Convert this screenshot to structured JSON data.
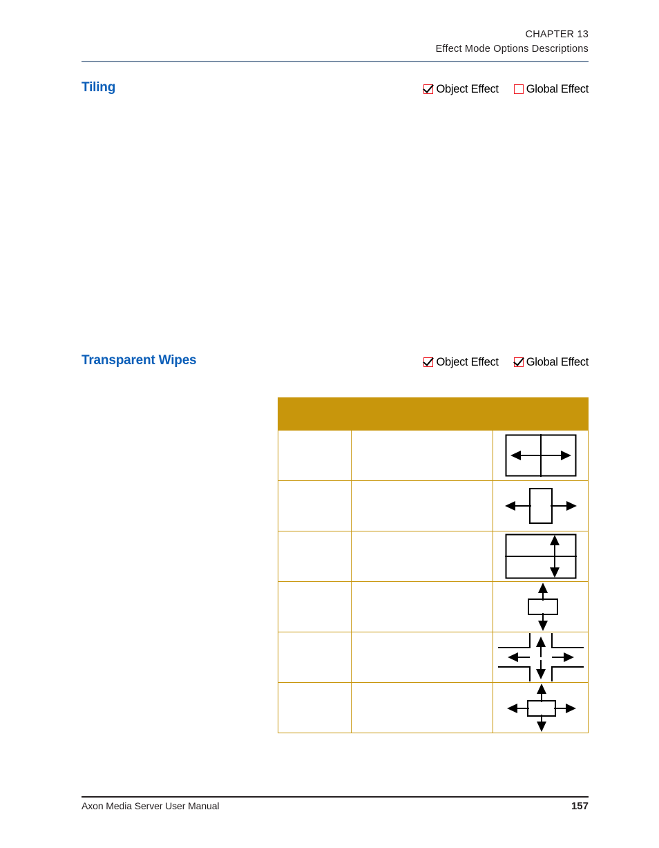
{
  "header": {
    "chapter_label": "CHAPTER 13",
    "chapter_title": "Effect Mode Options Descriptions",
    "rule_color": "#7b90a8"
  },
  "colors": {
    "heading_blue": "#0b5eb8",
    "table_gold": "#c8960c",
    "checkbox_red": "#ee1c25",
    "body_black": "#231f20"
  },
  "sections": [
    {
      "title": "Tiling",
      "flags": [
        {
          "label": "Object Effect",
          "checked": true,
          "icon": "checkbox-checked-icon"
        },
        {
          "label": "Global Effect",
          "checked": false,
          "icon": "checkbox-unchecked-icon"
        }
      ]
    },
    {
      "title": "Transparent Wipes",
      "flags": [
        {
          "label": "Object Effect",
          "checked": true,
          "icon": "checkbox-checked-icon"
        },
        {
          "label": "Global Effect",
          "checked": true,
          "icon": "checkbox-checked-icon"
        }
      ]
    }
  ],
  "wipe_table": {
    "columns": [
      "",
      "",
      ""
    ],
    "rows": [
      {
        "name": "",
        "description": "",
        "icon": "wipe-split-horizontal-outward-icon"
      },
      {
        "name": "",
        "description": "",
        "icon": "wipe-box-horizontal-outward-icon"
      },
      {
        "name": "",
        "description": "",
        "icon": "wipe-split-vertical-outward-icon"
      },
      {
        "name": "",
        "description": "",
        "icon": "wipe-box-vertical-outward-icon"
      },
      {
        "name": "",
        "description": "",
        "icon": "wipe-quadrant-open-icon"
      },
      {
        "name": "",
        "description": "",
        "icon": "wipe-box-four-way-outward-icon"
      }
    ]
  },
  "footer": {
    "text": "Axon Media Server User Manual",
    "page_number": "157"
  }
}
